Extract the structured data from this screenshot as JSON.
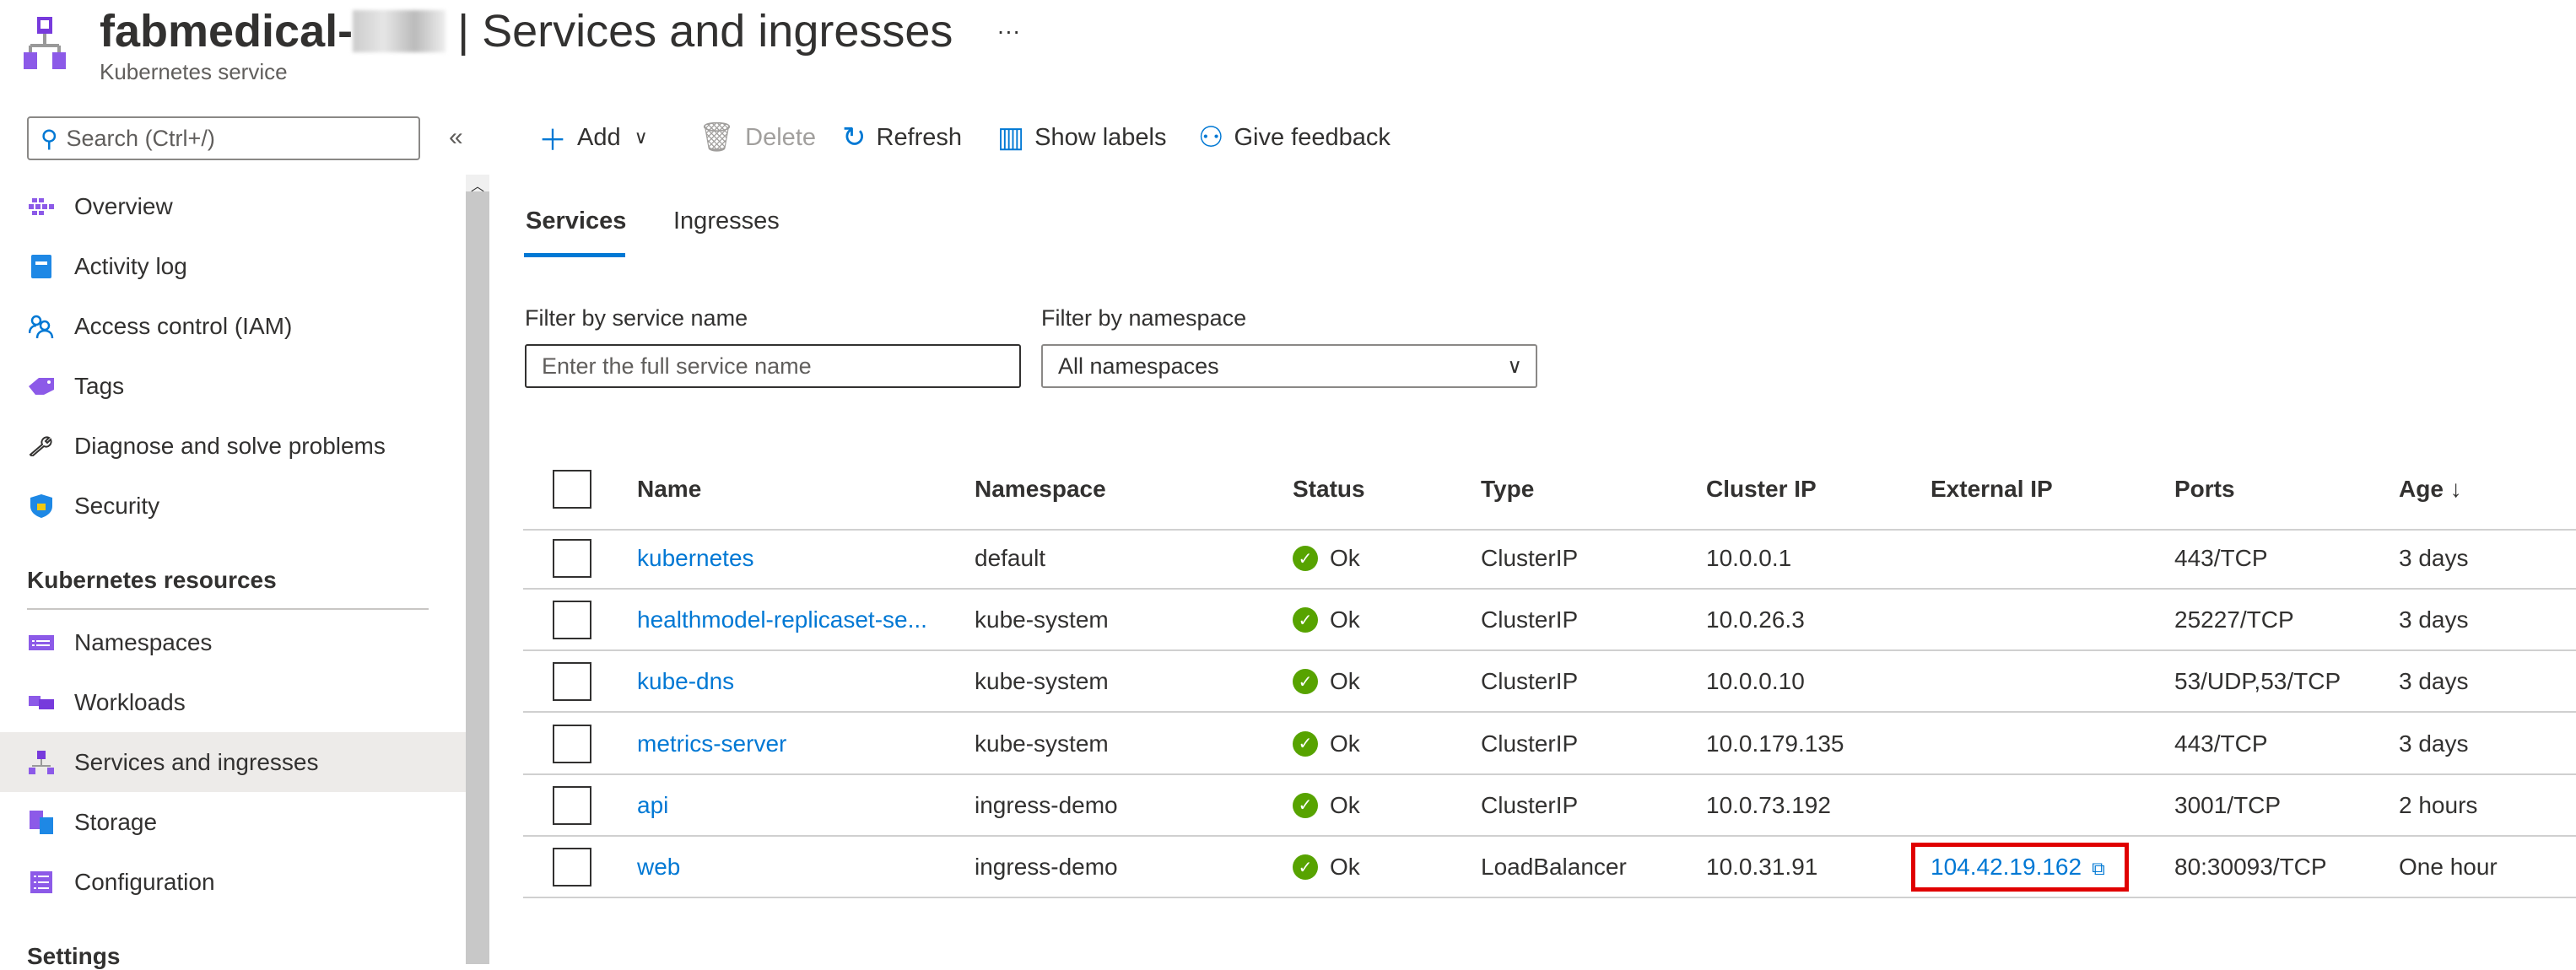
{
  "header": {
    "title_prefix": "fabmedical-",
    "title_suffix": "| Services and ingresses",
    "subtitle": "Kubernetes service",
    "more": "···"
  },
  "sidebar": {
    "search_placeholder": "Search (Ctrl+/)",
    "collapse": "«",
    "items": [
      {
        "label": "Overview",
        "icon": "overview-icon"
      },
      {
        "label": "Activity log",
        "icon": "activity-log-icon"
      },
      {
        "label": "Access control (IAM)",
        "icon": "iam-icon"
      },
      {
        "label": "Tags",
        "icon": "tag-icon"
      },
      {
        "label": "Diagnose and solve problems",
        "icon": "wrench-icon"
      },
      {
        "label": "Security",
        "icon": "shield-icon"
      }
    ],
    "section_k8s": "Kubernetes resources",
    "k8s_items": [
      {
        "label": "Namespaces"
      },
      {
        "label": "Workloads"
      },
      {
        "label": "Services and ingresses",
        "selected": true
      },
      {
        "label": "Storage"
      },
      {
        "label": "Configuration"
      }
    ],
    "section_settings": "Settings"
  },
  "toolbar": {
    "add": "Add",
    "delete": "Delete",
    "refresh": "Refresh",
    "show_labels": "Show labels",
    "feedback": "Give feedback"
  },
  "tabs": [
    {
      "label": "Services",
      "active": true
    },
    {
      "label": "Ingresses"
    }
  ],
  "filters": {
    "name_label": "Filter by service name",
    "name_placeholder": "Enter the full service name",
    "ns_label": "Filter by namespace",
    "ns_value": "All namespaces"
  },
  "table": {
    "columns": [
      "Name",
      "Namespace",
      "Status",
      "Type",
      "Cluster IP",
      "External IP",
      "Ports",
      "Age ↓"
    ],
    "rows": [
      {
        "name": "kubernetes",
        "ns": "default",
        "status": "Ok",
        "type": "ClusterIP",
        "cip": "10.0.0.1",
        "eip": "",
        "ports": "443/TCP",
        "age": "3 days"
      },
      {
        "name": "healthmodel-replicaset-se...",
        "ns": "kube-system",
        "status": "Ok",
        "type": "ClusterIP",
        "cip": "10.0.26.3",
        "eip": "",
        "ports": "25227/TCP",
        "age": "3 days"
      },
      {
        "name": "kube-dns",
        "ns": "kube-system",
        "status": "Ok",
        "type": "ClusterIP",
        "cip": "10.0.0.10",
        "eip": "",
        "ports": "53/UDP,53/TCP",
        "age": "3 days"
      },
      {
        "name": "metrics-server",
        "ns": "kube-system",
        "status": "Ok",
        "type": "ClusterIP",
        "cip": "10.0.179.135",
        "eip": "",
        "ports": "443/TCP",
        "age": "3 days"
      },
      {
        "name": "api",
        "ns": "ingress-demo",
        "status": "Ok",
        "type": "ClusterIP",
        "cip": "10.0.73.192",
        "eip": "",
        "ports": "3001/TCP",
        "age": "2 hours"
      },
      {
        "name": "web",
        "ns": "ingress-demo",
        "status": "Ok",
        "type": "LoadBalancer",
        "cip": "10.0.31.91",
        "eip": "104.42.19.162",
        "ports": "80:30093/TCP",
        "age": "One hour",
        "highlighted": true
      }
    ]
  },
  "colors": {
    "accent": "#0078d4",
    "ok": "#57a300",
    "highlight": "#e00000",
    "k8s_purple": "#773adc"
  }
}
